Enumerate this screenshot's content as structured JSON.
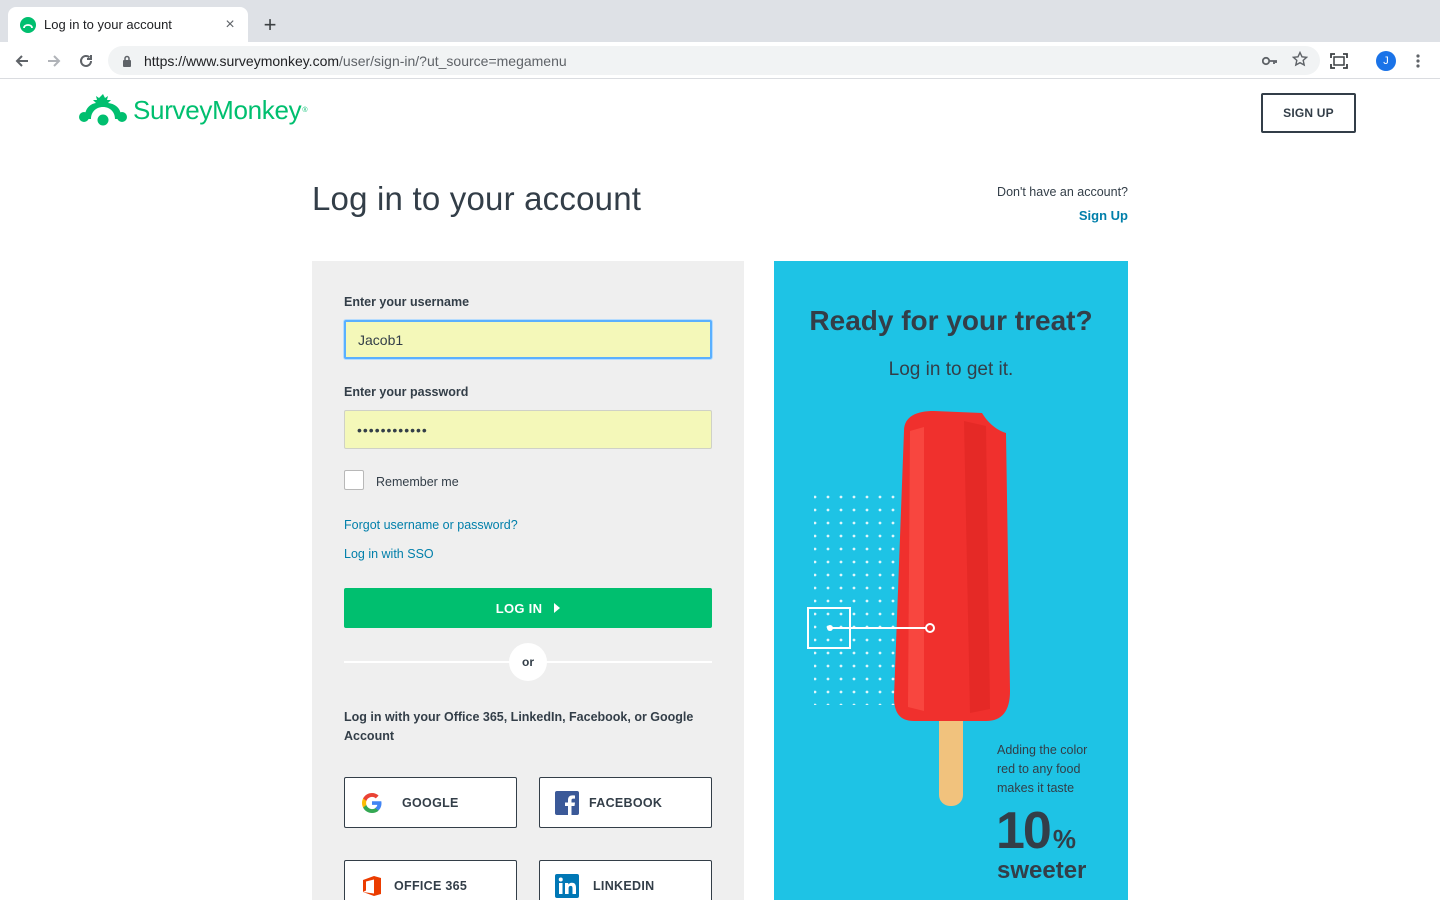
{
  "browser": {
    "tab_title": "Log in to your account",
    "tab_close": "×",
    "new_tab": "+",
    "url_host": "https://www.surveymonkey.com",
    "url_path": "/user/sign-in/?ut_source=megamenu",
    "avatar_initial": "J"
  },
  "header": {
    "logo_text": "SurveyMonkey",
    "logo_reg": "®",
    "signup_button": "SIGN UP"
  },
  "page": {
    "title": "Log in to your account",
    "no_account_text": "Don't have an account?",
    "signup_link": "Sign Up"
  },
  "form": {
    "username_label": "Enter your username",
    "username_value": "Jacob1",
    "password_label": "Enter your password",
    "password_value": "••••••••••••",
    "remember_label": "Remember me",
    "forgot_link": "Forgot username or password?",
    "sso_link": "Log in with SSO",
    "login_button": "LOG IN",
    "or_text": "or",
    "social_prompt": "Log in with your Office 365, LinkedIn, Facebook, or Google Account",
    "social_buttons": {
      "google": "GOOGLE",
      "facebook": "FACEBOOK",
      "office": "OFFICE 365",
      "linkedin": "LINKEDIN"
    }
  },
  "promo": {
    "headline": "Ready for your treat?",
    "subheadline": "Log in to get it.",
    "fact": "Adding the color red to any food makes it taste",
    "number": "10",
    "percent": "%",
    "sweeter": "sweeter"
  },
  "colors": {
    "brand_green": "#00bf6f",
    "link_blue": "#007faa",
    "promo_background": "#1ec3e5",
    "autofill_yellow": "#f4f8b9"
  }
}
